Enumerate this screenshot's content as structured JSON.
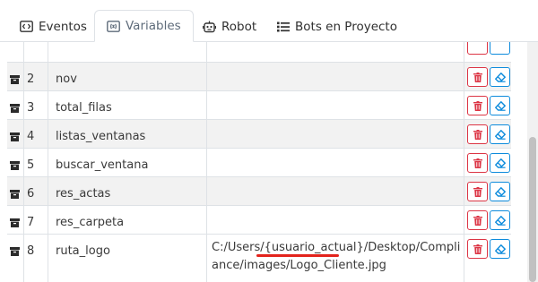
{
  "tabs": [
    {
      "label": "Eventos",
      "icon": "code-icon",
      "active": false
    },
    {
      "label": "Variables",
      "icon": "variable-icon",
      "active": true
    },
    {
      "label": "Robot",
      "icon": "robot-icon",
      "active": false
    },
    {
      "label": "Bots en Proyecto",
      "icon": "list-icon",
      "active": false
    }
  ],
  "table": {
    "rows": [
      {
        "index": "",
        "name": "",
        "value": ""
      },
      {
        "index": "2",
        "name": "nov",
        "value": ""
      },
      {
        "index": "3",
        "name": "total_filas",
        "value": ""
      },
      {
        "index": "4",
        "name": "listas_ventanas",
        "value": ""
      },
      {
        "index": "5",
        "name": "buscar_ventana",
        "value": ""
      },
      {
        "index": "6",
        "name": "res_actas",
        "value": ""
      },
      {
        "index": "7",
        "name": "res_carpeta",
        "value": ""
      },
      {
        "index": "8",
        "name": "ruta_logo",
        "value": "C:/Users/{usuario_actual}/Desktop/Compliance/images/Logo_Cliente.jpg"
      }
    ]
  },
  "colors": {
    "delete": "#dc3545",
    "clear": "#0d8bdc",
    "annotation": "#e3231c"
  }
}
